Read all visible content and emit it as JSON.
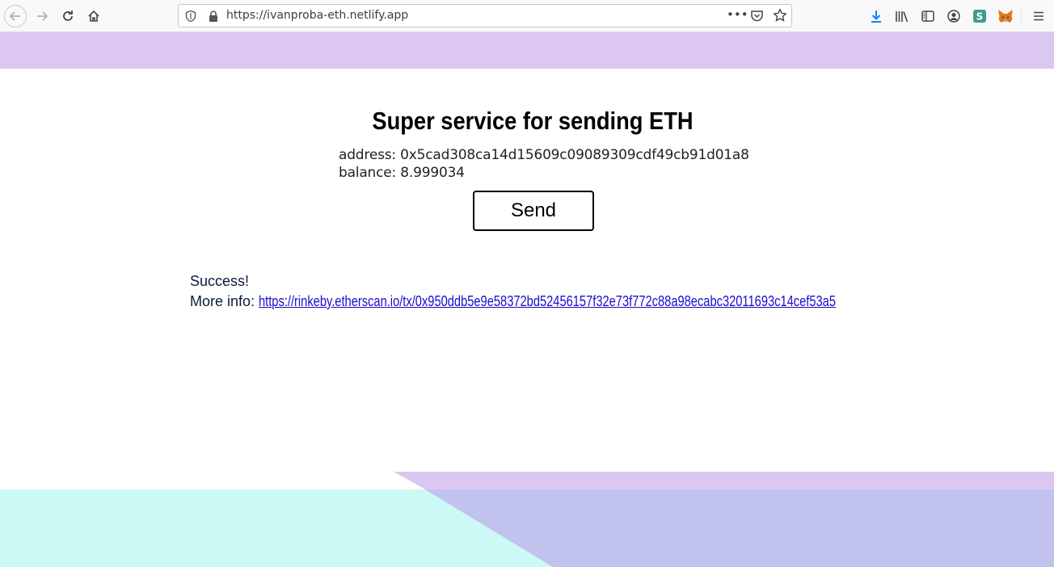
{
  "browser": {
    "url": "https://ivanproba-eth.netlify.app",
    "icons": {
      "back": "arrow-left-icon",
      "forward": "arrow-right-icon",
      "reload": "reload-icon",
      "home": "home-icon",
      "shield": "shield-icon",
      "lock": "lock-icon",
      "more": "more-dots-icon",
      "pocket": "pocket-icon",
      "bookmark": "star-icon",
      "download": "download-icon",
      "library": "library-icon",
      "sidebar": "sidebar-icon",
      "account": "account-icon",
      "extension": "extension-s-icon",
      "metamask": "fox-icon",
      "menu": "hamburger-menu-icon"
    },
    "more_label": "•••"
  },
  "page": {
    "title": "Super service for sending ETH",
    "address_label": "address:",
    "address_value": "0x5cad308ca14d15609c09089309cdf49cb91d01a8",
    "balance_label": "balance:",
    "balance_value": "8.999034",
    "send_label": "Send",
    "status_text": "Success!",
    "more_info_label": "More info:",
    "tx_link": "https://rinkeby.etherscan.io/tx/0x950ddb5e9e58372bd52456157f32e73f772c88a98ecabc32011693c14cef53a5"
  },
  "colors": {
    "top_band": "#dcc7f0",
    "bottom_cyan": "#ccf8f5",
    "bottom_purple_light": "#dcc7f0",
    "bottom_purple": "#c2c2ee",
    "link": "#1a0dcc"
  }
}
